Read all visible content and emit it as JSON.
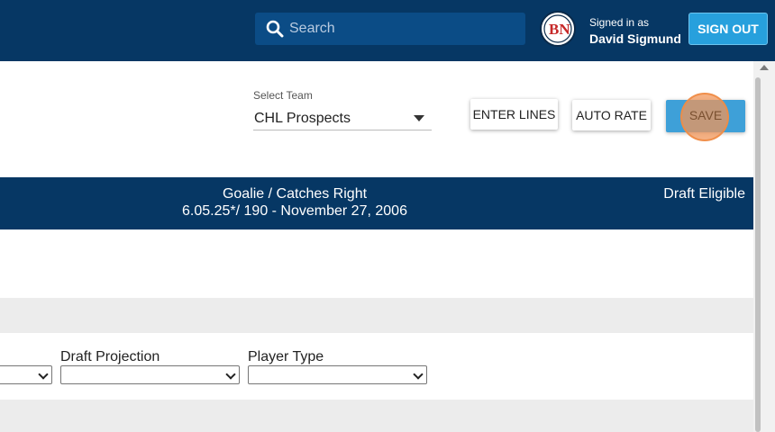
{
  "header": {
    "search": {
      "placeholder": "Search"
    },
    "user": {
      "avatar_initials": "BN",
      "signed_in_label": "Signed in as",
      "name": "David Sigmund"
    },
    "sign_out_label": "SIGN OUT"
  },
  "team_selector": {
    "label": "Select Team",
    "value": "CHL Prospects"
  },
  "toolbar": {
    "enter_lines_label": "ENTER LINES",
    "auto_rate_label": "AUTO RATE",
    "save_label": "SAVE"
  },
  "player": {
    "position": "Goalie / Catches Right",
    "bio": "6.05.25*/ 190 - November 27, 2006",
    "draft_status": "Draft Eligible"
  },
  "fields": {
    "draft_projection_label": "Draft Projection",
    "player_type_label": "Player Type"
  },
  "colors": {
    "header_bg": "#063764",
    "accent": "#27a0dd"
  }
}
